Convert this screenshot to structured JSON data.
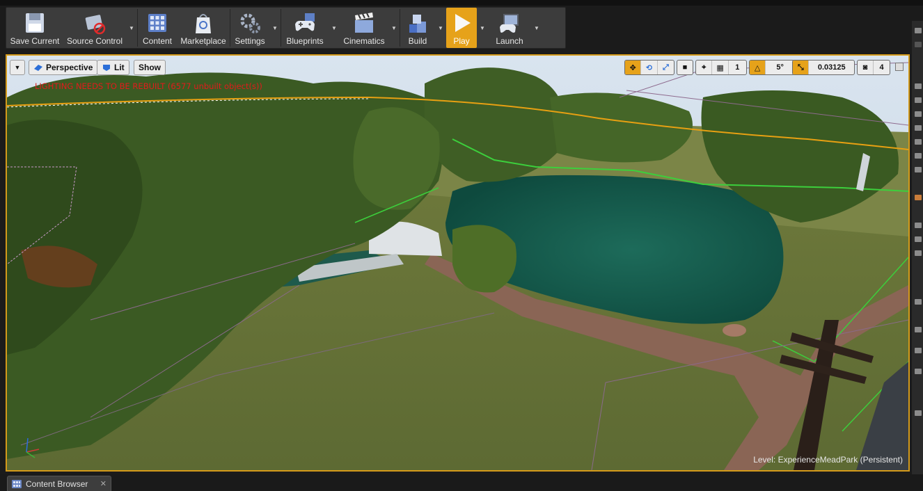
{
  "toolbar": {
    "items": [
      {
        "label": "Save Current",
        "icon": "floppy-disk-icon"
      },
      {
        "label": "Source Control",
        "icon": "source-control-icon"
      },
      {
        "label": "Content",
        "icon": "content-grid-icon"
      },
      {
        "label": "Marketplace",
        "icon": "marketplace-bag-icon"
      },
      {
        "label": "Settings",
        "icon": "gear-icon"
      },
      {
        "label": "Blueprints",
        "icon": "gamepad-icon"
      },
      {
        "label": "Cinematics",
        "icon": "clapperboard-icon"
      },
      {
        "label": "Build",
        "icon": "build-blocks-icon"
      },
      {
        "label": "Play",
        "icon": "play-icon"
      },
      {
        "label": "Launch",
        "icon": "launch-console-icon"
      }
    ]
  },
  "viewport": {
    "view_mode": "Perspective",
    "lighting_mode": "Lit",
    "show_label": "Show",
    "warning": "LIGHTING NEEDS TO BE REBUILT (6577 unbuilt object(s))",
    "grid_snap_value": "1",
    "rotation_snap_value": "5°",
    "scale_snap_value": "0.03125",
    "camera_speed": "4",
    "level_prefix": "Level:",
    "level_name": "ExperienceMeadPark (Persistent)"
  },
  "bottom": {
    "tab_label": "Content Browser",
    "close_glyph": "✕"
  },
  "colors": {
    "accent": "#e6a21a",
    "warning_red": "#e21b1b",
    "toolbar_bg": "#3c3c3c",
    "viewport_border": "#d49a1a"
  }
}
